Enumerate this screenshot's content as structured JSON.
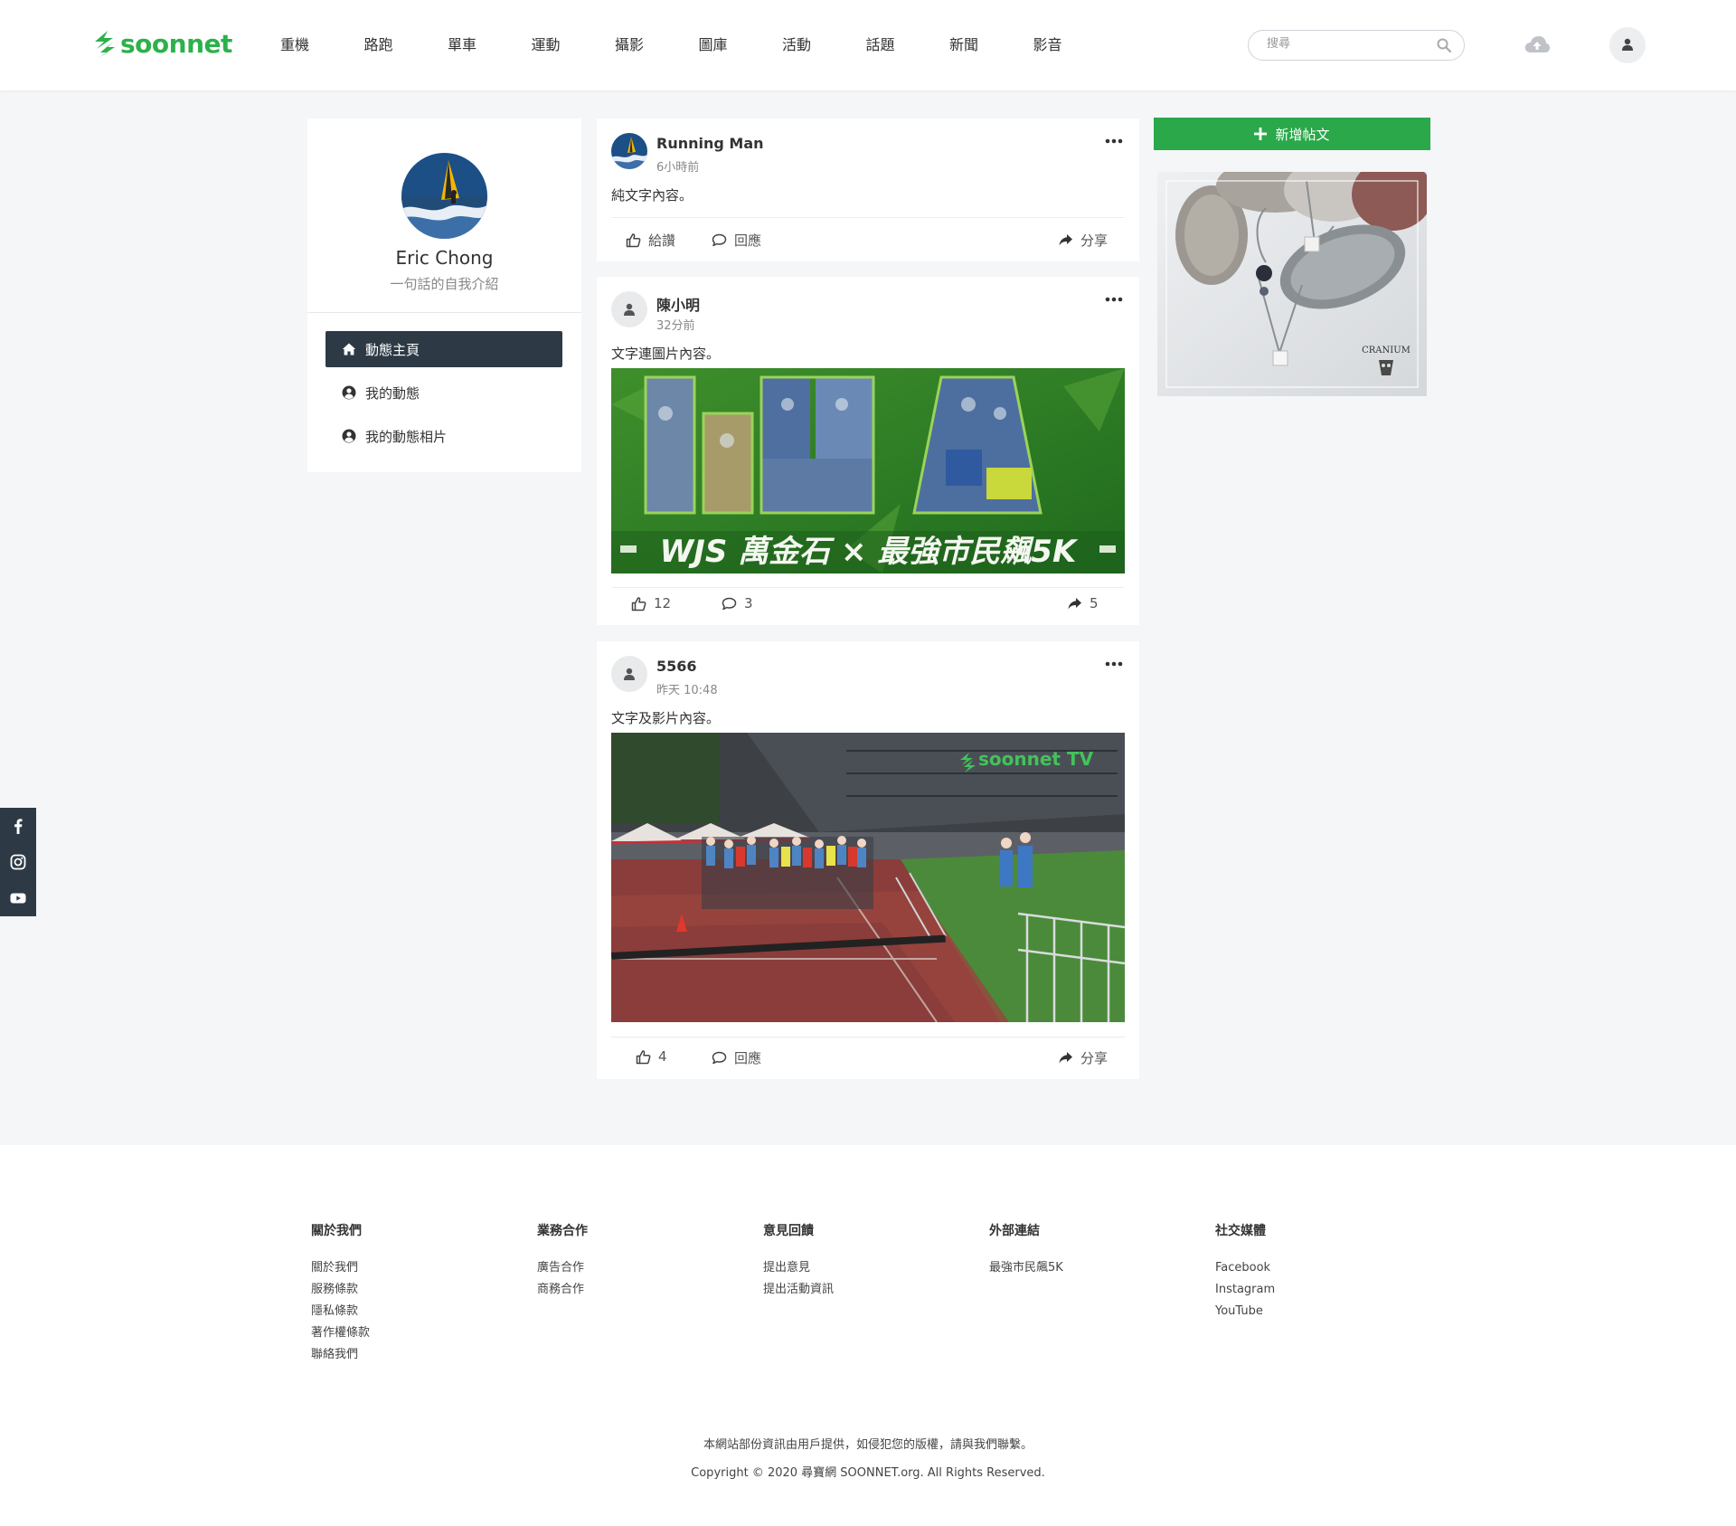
{
  "header": {
    "logo_text": "soonnet",
    "nav": [
      "重機",
      "路跑",
      "單車",
      "運動",
      "攝影",
      "圖庫",
      "活動",
      "話題",
      "新聞",
      "影音"
    ],
    "search_placeholder": "搜尋"
  },
  "profile": {
    "name": "Eric Chong",
    "bio": "一句話的自我介紹",
    "menu": [
      {
        "label": "動態主頁",
        "icon": "home-icon",
        "active": true
      },
      {
        "label": "我的動態",
        "icon": "user-circle-icon",
        "active": false
      },
      {
        "label": "我的動態相片",
        "icon": "user-circle-icon",
        "active": false
      }
    ]
  },
  "posts": [
    {
      "author": "Running Man",
      "time": "6小時前",
      "text": "純文字內容。",
      "actions": {
        "like": "給讚",
        "reply": "回應",
        "share": "分享"
      }
    },
    {
      "author": "陳小明",
      "time": "32分前",
      "text": "文字連圖片內容。",
      "media_caption": "WJS 萬金石 × 最強市民飆5K",
      "actions": {
        "like": "12",
        "reply": "3",
        "share": "5"
      }
    },
    {
      "author": "5566",
      "time": "昨天 10:48",
      "text": "文字及影片內容。",
      "media_watermark": "soonnet TV",
      "actions": {
        "like": "4",
        "reply": "回應",
        "share": "分享"
      }
    }
  ],
  "sidebar_right": {
    "new_post_label": "新增帖文",
    "ad_mark": "CRANIUM"
  },
  "footer": {
    "columns": [
      {
        "title": "關於我們",
        "links": [
          "關於我們",
          "服務條款",
          "隱私條款",
          "著作權條款",
          "聯絡我們"
        ]
      },
      {
        "title": "業務合作",
        "links": [
          "廣告合作",
          "商務合作"
        ]
      },
      {
        "title": "意見回饋",
        "links": [
          "提出意見",
          "提出活動資訊"
        ]
      },
      {
        "title": "外部連結",
        "links": [
          "最強市民飆5K"
        ]
      },
      {
        "title": "社交媒體",
        "links": [
          "Facebook",
          "Instagram",
          "YouTube"
        ]
      }
    ],
    "note": "本網站部份資訊由用戶提供，如侵犯您的版權，請與我們聯繫。",
    "copyright": "Copyright © 2020 尋寶網 SOONNET.org. All Rights Reserved."
  },
  "colors": {
    "brand_green": "#2db14b",
    "button_green": "#2aa84a",
    "dark_navy": "#2d3a46"
  }
}
